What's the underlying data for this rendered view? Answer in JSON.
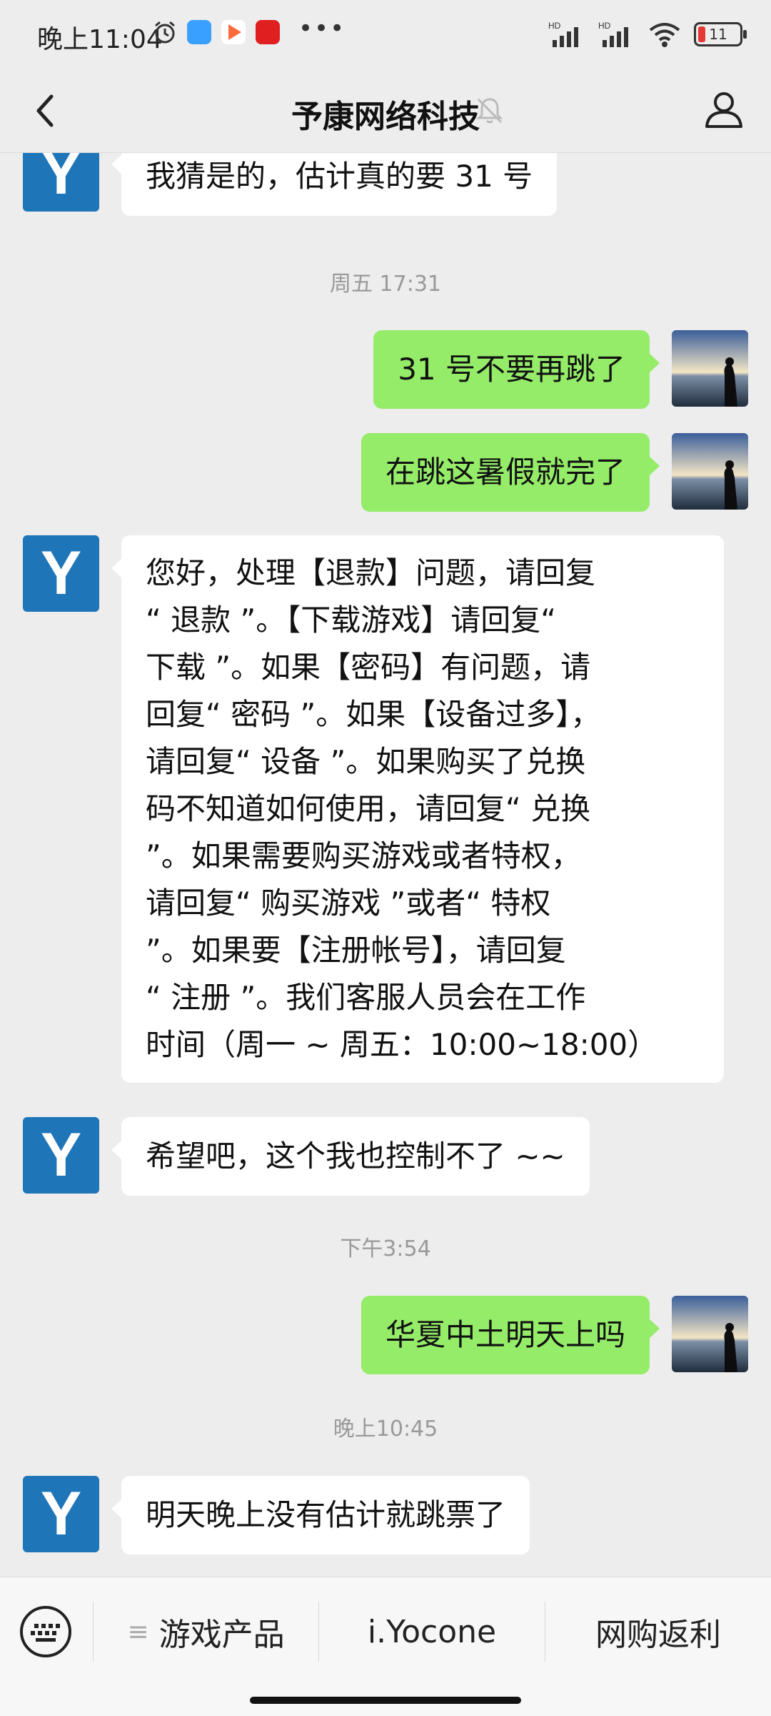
{
  "status": {
    "time": "晚上11:04",
    "dots": "•••",
    "battery": "11",
    "signal_tag": "HD"
  },
  "header": {
    "title": "予康网络科技"
  },
  "messages": {
    "m1": "我猜是的，估计真的要 31 号",
    "t1": "周五 17:31",
    "m2": "31 号不要再跳了",
    "m3": "在跳这暑假就完了",
    "m4": [
      "您好，处理【退款】问题，请回复",
      "“ 退款 ”。【下载游戏】请回复“",
      "下载 ”。如果【密码】有问题，请",
      "回复“ 密码 ”。如果【设备过多】，",
      "请回复“ 设备 ”。如果购买了兑换",
      "码不知道如何使用，请回复“ 兑换",
      "”。如果需要购买游戏或者特权，",
      "请回复“ 购买游戏 ”或者“ 特权",
      "”。如果要【注册帐号】，请回复",
      "“ 注册 ”。我们客服人员会在工作",
      "时间（周一 ~ 周五：10:00~18:00）"
    ],
    "m5": "希望吧，这个我也控制不了 ~~",
    "t2": "下午3:54",
    "m6": "华夏中土明天上吗",
    "t3": "晚上10:45",
    "m7": "明天晚上没有估计就跳票了"
  },
  "avatar_letter": "Y",
  "menu": {
    "item1": "游戏产品",
    "item2": "i.Yocone",
    "item3": "网购返利",
    "menu_glyph": "≡"
  },
  "colors": {
    "bg": "#ededed",
    "sent": "#95ec69",
    "received": "#ffffff",
    "avatar": "#1e75b8"
  }
}
